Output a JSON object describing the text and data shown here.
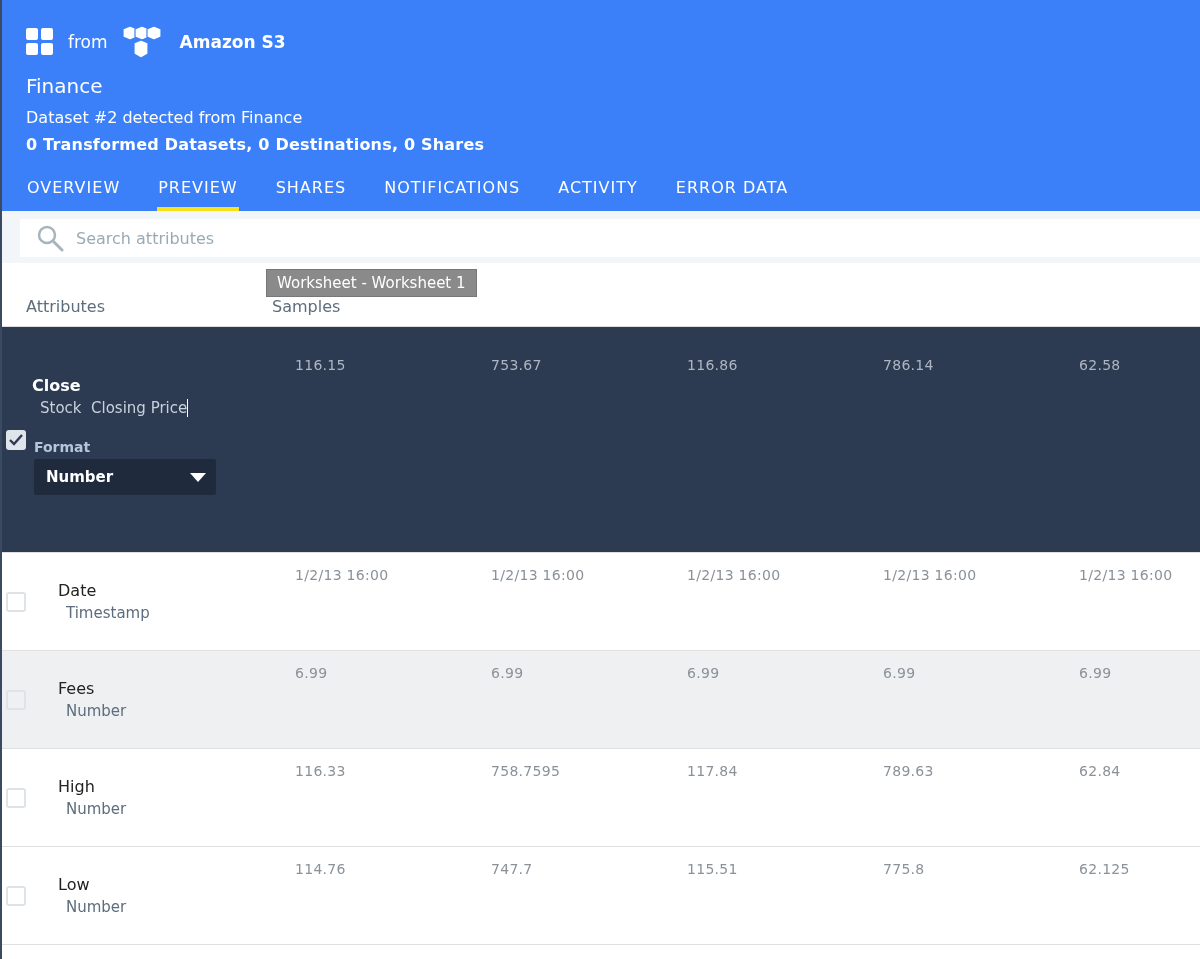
{
  "header": {
    "from_label": "from",
    "source": "Amazon S3",
    "title": "Finance",
    "subtitle": "Dataset #2 detected from Finance",
    "summary": "0 Transformed Datasets, 0 Destinations, 0 Shares"
  },
  "tabs": [
    {
      "label": "OVERVIEW",
      "selected": false
    },
    {
      "label": "PREVIEW",
      "selected": true
    },
    {
      "label": "SHARES",
      "selected": false
    },
    {
      "label": "NOTIFICATIONS",
      "selected": false
    },
    {
      "label": "ACTIVITY",
      "selected": false
    },
    {
      "label": "ERROR DATA",
      "selected": false
    }
  ],
  "search": {
    "placeholder": "Search attributes"
  },
  "tooltip": "Worksheet - Worksheet 1",
  "table": {
    "columns": [
      "Attributes",
      "Samples"
    ],
    "rows": [
      {
        "name": "Close",
        "description": "Stock  Closing Price",
        "checked": true,
        "expanded": true,
        "highlighted": false,
        "format_label": "Format",
        "format": "Number",
        "samples": [
          "116.15",
          "753.67",
          "116.86",
          "786.14",
          "62.58"
        ]
      },
      {
        "name": "Date",
        "description": "Timestamp",
        "checked": false,
        "expanded": false,
        "highlighted": false,
        "samples": [
          "1/2/13 16:00",
          "1/2/13 16:00",
          "1/2/13 16:00",
          "1/2/13 16:00",
          "1/2/13 16:00"
        ]
      },
      {
        "name": "Fees",
        "description": "Number",
        "checked": false,
        "expanded": false,
        "highlighted": true,
        "samples": [
          "6.99",
          "6.99",
          "6.99",
          "6.99",
          "6.99"
        ]
      },
      {
        "name": "High",
        "description": "Number",
        "checked": false,
        "expanded": false,
        "highlighted": false,
        "samples": [
          "116.33",
          "758.7595",
          "117.84",
          "789.63",
          "62.84"
        ]
      },
      {
        "name": "Low",
        "description": "Number",
        "checked": false,
        "expanded": false,
        "highlighted": false,
        "samples": [
          "114.76",
          "747.7",
          "115.51",
          "775.8",
          "62.125"
        ]
      }
    ]
  }
}
